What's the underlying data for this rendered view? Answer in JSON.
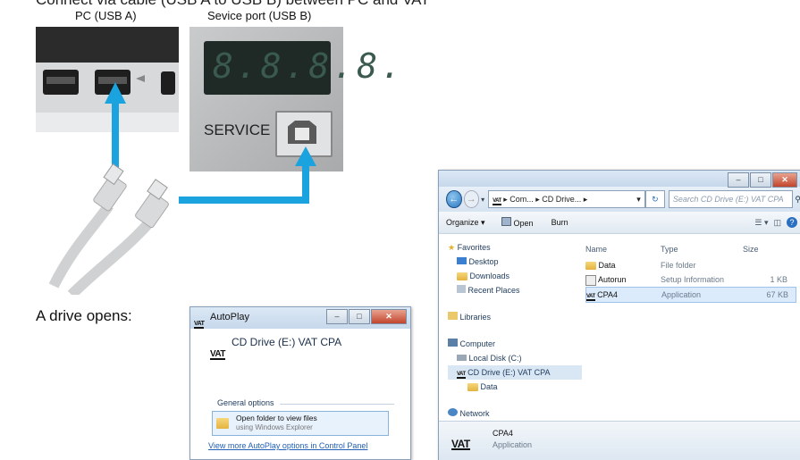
{
  "top_caption": "Connect via cable (USB A to USB B) between PC and VAT",
  "labels": {
    "pc_port": "PC (USB A)",
    "service_port": "Sevice port (USB B)",
    "service_text": "SERVICE",
    "seven_segment": "8.8.8.8.",
    "drive_opens": "A drive opens:"
  },
  "colors": {
    "arrow": "#1aa3de"
  },
  "autoplay": {
    "title": "AutoPlay",
    "drive_title": "CD Drive (E:) VAT CPA",
    "section": "General options",
    "option_title": "Open folder to view files",
    "option_sub": "using Windows Explorer",
    "more_link": "View more AutoPlay options in Control Panel"
  },
  "explorer": {
    "breadcrumb": "▸ Com... ▸ CD Drive... ▸",
    "search_placeholder": "Search CD Drive (E:) VAT CPA",
    "toolbar": {
      "organize": "Organize ▾",
      "open": "Open",
      "burn": "Burn"
    },
    "nav": {
      "favorites": "Favorites",
      "desktop": "Desktop",
      "downloads": "Downloads",
      "recent": "Recent Places",
      "libraries": "Libraries",
      "computer": "Computer",
      "local_disk": "Local Disk (C:)",
      "cd_drive": "CD Drive (E:) VAT CPA",
      "data": "Data",
      "network": "Network"
    },
    "columns": {
      "name": "Name",
      "type": "Type",
      "size": "Size"
    },
    "files": [
      {
        "name": "Data",
        "type": "File folder",
        "size": "",
        "icon": "folder-icon"
      },
      {
        "name": "Autorun",
        "type": "Setup Information",
        "size": "1 KB",
        "icon": "settings-file-icon"
      },
      {
        "name": "CPA4",
        "type": "Application",
        "size": "67 KB",
        "icon": "vat-app-icon"
      }
    ],
    "details": {
      "name": "CPA4",
      "type": "Application"
    }
  }
}
